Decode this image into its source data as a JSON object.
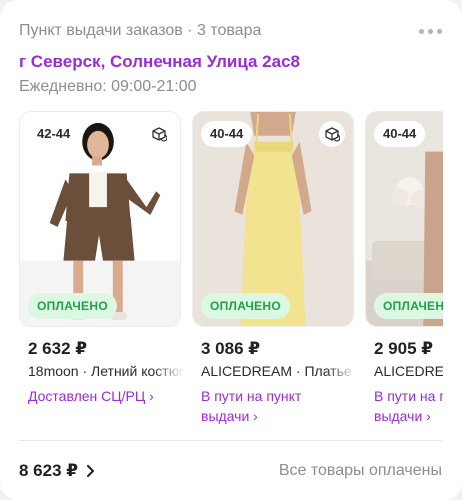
{
  "header": {
    "title": "Пункт выдачи заказов · 3 товара",
    "address": "г Северск, Солнечная Улица 2ас8",
    "hours": "Ежедневно: 09:00-21:00"
  },
  "colors": {
    "accent": "#9a2bd6",
    "paid_text": "#1fa24a",
    "paid_bg": "#dcf7e2",
    "muted": "#8c8c93"
  },
  "items": [
    {
      "size": "42-44",
      "badge": "ОПЛАЧЕНО",
      "price": "2 632 ₽",
      "seller": "18moon · Летний костюм",
      "status": "Доставлен СЦ/РЦ ›",
      "icon": "box-return-icon"
    },
    {
      "size": "40-44",
      "badge": "ОПЛАЧЕНО",
      "price": "3 086 ₽",
      "seller": "ALICEDREAM · Платье",
      "status": "В пути на пункт выдачи ›",
      "icon": "box-return-icon"
    },
    {
      "size": "40-44",
      "badge": "ОПЛАЧЕНО",
      "price": "2 905 ₽",
      "seller": "ALICEDREAM",
      "status": "В пути на пункт выдачи ›"
    }
  ],
  "footer": {
    "total": "8 623 ₽",
    "status": "Все товары оплачены"
  }
}
